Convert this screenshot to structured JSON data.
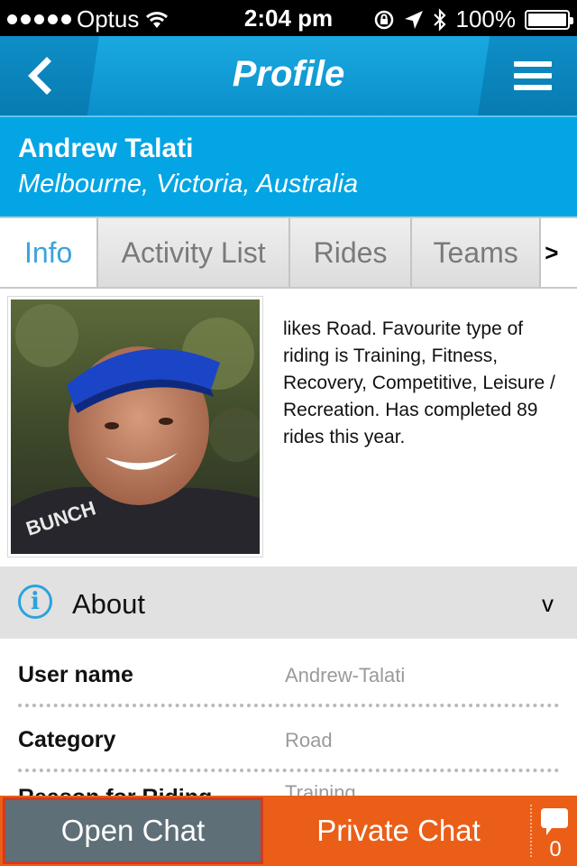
{
  "status_bar": {
    "carrier": "Optus",
    "time": "2:04 pm",
    "battery": "100%"
  },
  "nav": {
    "title": "Profile"
  },
  "profile": {
    "name": "Andrew Talati",
    "location": "Melbourne, Victoria, Australia",
    "bio": "likes Road. Favourite type of riding is Training, Fitness, Recovery, Competitive, Leisure / Recreation. Has completed 89 rides this year."
  },
  "tabs": [
    {
      "label": "Info",
      "active": true
    },
    {
      "label": "Activity List",
      "active": false
    },
    {
      "label": "Rides",
      "active": false
    },
    {
      "label": "Teams",
      "active": false
    }
  ],
  "tabs_more": ">",
  "about": {
    "label": "About",
    "chevron": "v"
  },
  "details": [
    {
      "key": "User name",
      "value": "Andrew-Talati"
    },
    {
      "key": "Category",
      "value": "Road"
    },
    {
      "key": "Reason for Riding",
      "value": "Training"
    }
  ],
  "bottom": {
    "open_chat": "Open Chat",
    "private_chat": "Private Chat",
    "chat_count": "0"
  },
  "colors": {
    "nav_blue": "#0a8fcb",
    "header_blue": "#03a5e4",
    "tab_active_text": "#3aa3dc",
    "chat_orange": "#ea5e17",
    "open_chat_gray": "#5e6f77"
  },
  "icons": {
    "back": "chevron-left-icon",
    "menu": "hamburger-menu-icon",
    "info": "info-icon",
    "chat": "speech-bubble-icon"
  }
}
